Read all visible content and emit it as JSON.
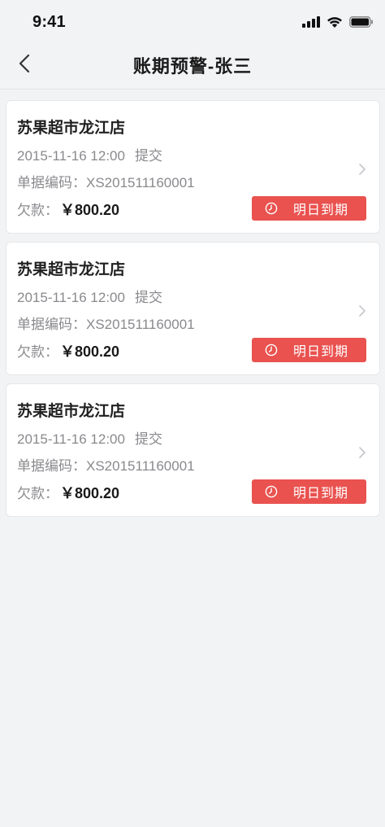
{
  "status_bar": {
    "time": "9:41",
    "icons": [
      "signal-icon",
      "wifi-icon",
      "battery-icon"
    ]
  },
  "nav": {
    "back_icon": "chevron-left-icon",
    "title": "账期预警-张三"
  },
  "colors": {
    "background": "#f2f3f5",
    "card": "#ffffff",
    "badge": "#e9524f",
    "secondary_text": "#8a8a8e"
  },
  "cards": [
    {
      "store": "苏果超市龙江店",
      "date": "2015-11-16 12:00",
      "submit": "提交",
      "code_label": "单据编码：",
      "code": "XS201511160001",
      "debt_label": "欠款：",
      "amount": "￥800.20",
      "badge": "明日到期"
    },
    {
      "store": "苏果超市龙江店",
      "date": "2015-11-16 12:00",
      "submit": "提交",
      "code_label": "单据编码：",
      "code": "XS201511160001",
      "debt_label": "欠款：",
      "amount": "￥800.20",
      "badge": "明日到期"
    },
    {
      "store": "苏果超市龙江店",
      "date": "2015-11-16 12:00",
      "submit": "提交",
      "code_label": "单据编码：",
      "code": "XS201511160001",
      "debt_label": "欠款：",
      "amount": "￥800.20",
      "badge": "明日到期"
    }
  ]
}
